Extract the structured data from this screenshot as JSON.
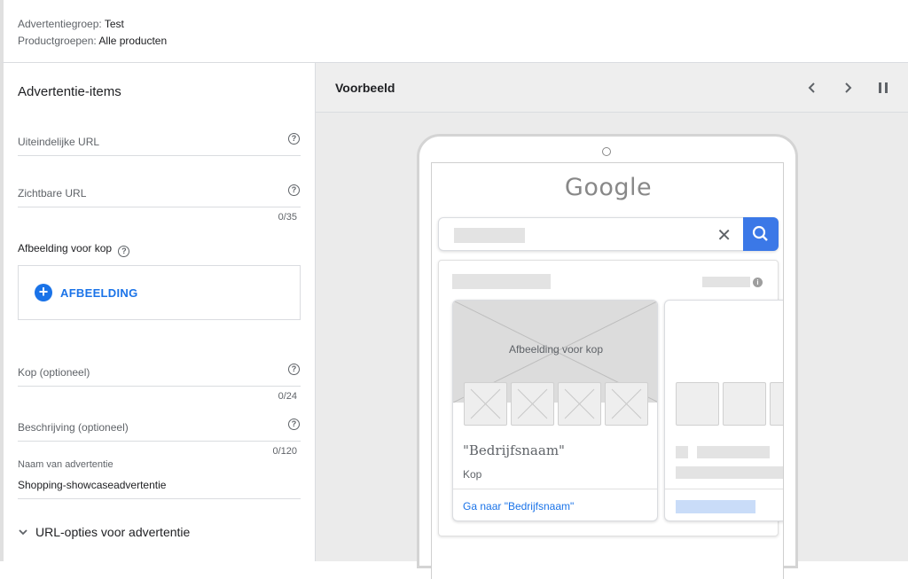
{
  "header": {
    "adgroup_label": "Advertentiegroep:",
    "adgroup_value": "Test",
    "productgroups_label": "Productgroepen:",
    "productgroups_value": "Alle producten"
  },
  "form": {
    "section_title": "Advertentie-items",
    "final_url_label": "Uiteindelijke URL",
    "display_url_label": "Zichtbare URL",
    "display_url_counter": "0/35",
    "header_image_label": "Afbeelding voor kop",
    "image_button_label": "AFBEELDING",
    "headline_label": "Kop (optioneel)",
    "headline_counter": "0/24",
    "description_label": "Beschrijving (optioneel)",
    "description_counter": "0/120",
    "ad_name_label": "Naam van advertentie",
    "ad_name_value": "Shopping-showcaseadvertentie",
    "url_options_label": "URL-opties voor advertentie"
  },
  "preview": {
    "title": "Voorbeeld",
    "google_logo": "Google",
    "hero_label": "Afbeelding voor kop",
    "business_name": "\"Bedrijfsnaam\"",
    "headline": "Kop",
    "cta": "Ga naar \"Bedrijfsnaam\""
  },
  "icons": {
    "help": "help-circle-icon",
    "prev": "chevron-left-icon",
    "next": "chevron-right-icon",
    "pause": "pause-icon",
    "clear": "close-icon",
    "search": "search-icon",
    "info": "info-icon",
    "expand": "chevron-down-icon",
    "add": "plus-circle-icon"
  },
  "colors": {
    "accent": "#1a73e8",
    "search_button": "#3b78e7"
  }
}
